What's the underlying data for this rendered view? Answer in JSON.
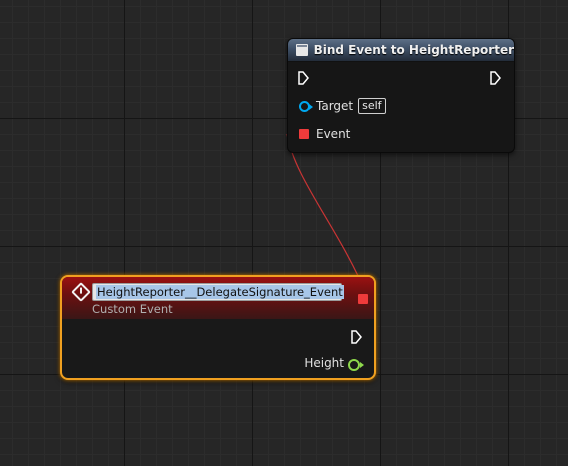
{
  "bind_node": {
    "title": "Bind Event to HeightReporter",
    "target_label": "Target",
    "target_value": "self",
    "event_label": "Event"
  },
  "event_node": {
    "name": "HeightReporter__DelegateSignature_Event",
    "subtitle": "Custom Event",
    "output_label": "Height"
  },
  "colors": {
    "exec_pin": "#ffffff",
    "object_pin": "#00a8f0",
    "delegate_pin": "#ee3b3b",
    "float_pin": "#8ed84c",
    "selection_outline": "#f0a020",
    "wire": "#c83434"
  }
}
